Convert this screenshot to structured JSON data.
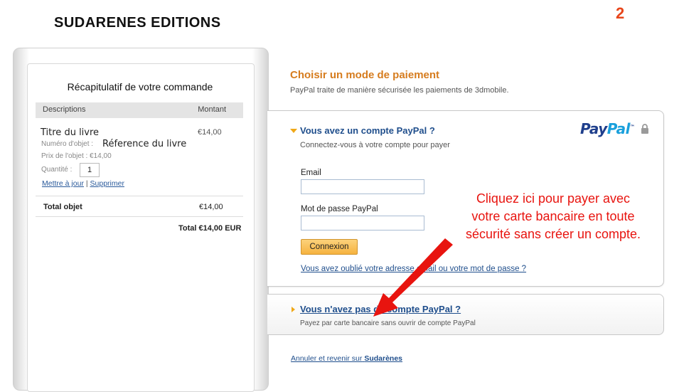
{
  "brand": "SUDARENES EDITIONS",
  "step_number": "2",
  "cart": {
    "title": "Récapitulatif de votre commande",
    "col_descriptions": "Descriptions",
    "col_montant": "Montant",
    "item_title": "Titre du livre",
    "item_price": "€14,00",
    "ref_label": "Numéro d'objet :",
    "ref_value": "Réference du livre",
    "unit_price": "Prix de l'objet : €14,00",
    "qty_label": "Quantité :",
    "qty_value": "1",
    "update_link": "Mettre à jour",
    "separator": "|",
    "delete_link": "Supprimer",
    "total_object_label": "Total objet",
    "total_object_value": "€14,00",
    "grand_total": "Total €14,00 EUR"
  },
  "payment": {
    "title": "Choisir un mode de paiement",
    "subtitle": "PayPal traite de manière sécurisée les paiements de 3dmobile.",
    "have_account": "Vous avez un compte PayPal ?",
    "connect_sub": "Connectez-vous à votre compte pour payer",
    "logo_pay": "Pay",
    "logo_pal": "Pal",
    "logo_tm": "™",
    "email_label": "Email",
    "email_value": "",
    "password_label": "Mot de passe PayPal",
    "password_value": "",
    "connexion_button": "Connexion",
    "forgot_link": "Vous avez oublié votre adresse email ou votre mot de passe ?",
    "no_account_link": "Vous n'avez pas de compte PayPal ?",
    "no_account_sub": "Payez par carte bancaire sans ouvrir de compte PayPal",
    "cancel_prefix": "Annuler et revenir sur",
    "cancel_brand": "Sudarènes"
  },
  "annotation": {
    "line1": "Cliquez ici pour payer avec",
    "line2": "votre carte bancaire en toute",
    "line3": "sécurité sans créer un compte."
  },
  "colors": {
    "accent_orange": "#d67c1e",
    "link_blue": "#1f4e8c",
    "annotation_red": "#e8140f",
    "button_gold": "#f6b33f"
  }
}
